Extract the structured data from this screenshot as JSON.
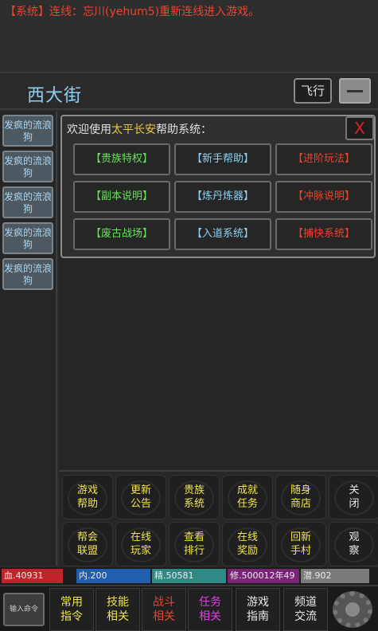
{
  "system_message": {
    "tag": "【系统】",
    "text": "连线：忘川(yehum5)重新连线进入游戏。"
  },
  "location": {
    "title": "西大街",
    "fly_label": "飞行"
  },
  "npcs": [
    "发疯的流浪狗",
    "发疯的流浪狗",
    "发疯的流浪狗",
    "发疯的流浪狗",
    "发疯的流浪狗"
  ],
  "help_dialog": {
    "title_prefix": "欢迎使用",
    "title_highlight": "太平长安",
    "title_suffix": "帮助系统：",
    "close_label": "X",
    "buttons": [
      {
        "label": "【贵族特权】",
        "color": "green"
      },
      {
        "label": "【新手帮助】",
        "color": "cyan"
      },
      {
        "label": "【进阶玩法】",
        "color": "red"
      },
      {
        "label": "【副本说明】",
        "color": "green"
      },
      {
        "label": "【炼丹炼器】",
        "color": "cyan"
      },
      {
        "label": "【冲脉说明】",
        "color": "red"
      },
      {
        "label": "【废古战场】",
        "color": "green"
      },
      {
        "label": "【入道系统】",
        "color": "cyan"
      },
      {
        "label": "【捕快系统】",
        "color": "red"
      }
    ]
  },
  "actions": [
    {
      "l1": "游戏",
      "l2": "帮助"
    },
    {
      "l1": "更新",
      "l2": "公告"
    },
    {
      "l1": "贵族",
      "l2": "系统"
    },
    {
      "l1": "成就",
      "l2": "任务"
    },
    {
      "l1": "随身",
      "l2": "商店"
    },
    {
      "l1": "关",
      "l2": "闭"
    },
    {
      "l1": "帮会",
      "l2": "联盟"
    },
    {
      "l1": "在线",
      "l2": "玩家"
    },
    {
      "l1": "查看",
      "l2": "排行"
    },
    {
      "l1": "在线",
      "l2": "奖励"
    },
    {
      "l1": "回新",
      "l2": "手村"
    },
    {
      "l1": "观",
      "l2": "察"
    }
  ],
  "stats": {
    "hp": "血.40931",
    "mp": "内.200",
    "jing": "精.50581",
    "xiu": "修.500012年49",
    "qian": "潜.902"
  },
  "stat_colors": {
    "hp": "#c0242a",
    "mp": "#1f5fae",
    "jing": "#2f8a86",
    "xiu": "#7a2478",
    "qian": "#7a7a7a"
  },
  "bottom_nav": {
    "input_label": "输入命令",
    "items": [
      {
        "l1": "常用",
        "l2": "指令"
      },
      {
        "l1": "技能",
        "l2": "相关"
      },
      {
        "l1": "战斗",
        "l2": "相关"
      },
      {
        "l1": "任务",
        "l2": "相关"
      },
      {
        "l1": "游戏",
        "l2": "指南"
      },
      {
        "l1": "频道",
        "l2": "交流"
      }
    ]
  }
}
